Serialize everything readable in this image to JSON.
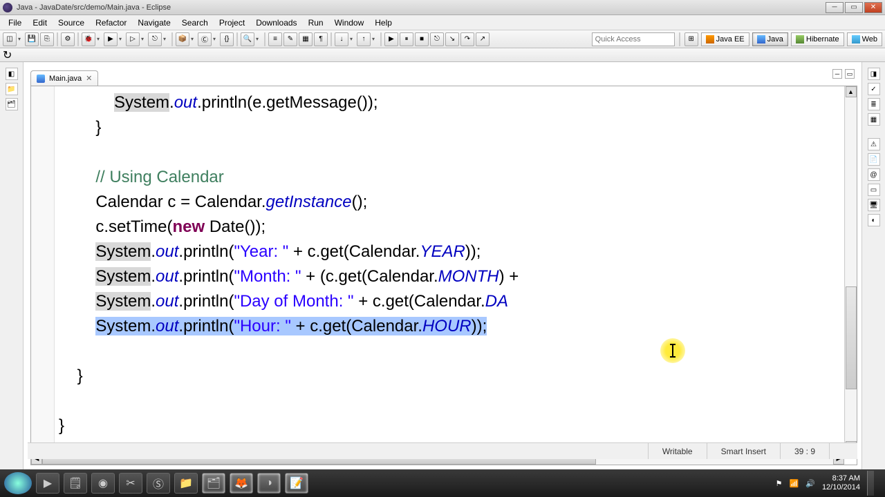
{
  "window": {
    "title": "Java - JavaDate/src/demo/Main.java - Eclipse"
  },
  "menu": {
    "file": "File",
    "edit": "Edit",
    "source": "Source",
    "refactor": "Refactor",
    "navigate": "Navigate",
    "search": "Search",
    "project": "Project",
    "downloads": "Downloads",
    "run": "Run",
    "window": "Window",
    "help": "Help"
  },
  "quickaccess": {
    "placeholder": "Quick Access"
  },
  "perspectives": {
    "javaee": "Java EE",
    "java": "Java",
    "hibernate": "Hibernate",
    "web": "Web"
  },
  "editor": {
    "tab_label": "Main.java",
    "code_prelude_sys": "System",
    "code_prelude_out": "out",
    "code_prelude_rest": ".println(e.getMessage());",
    "brace1": "}",
    "comment": "// Using Calendar",
    "l_cal_decl": "Calendar c = Calendar.",
    "l_cal_getinst": "getInstance",
    "l_cal_end": "();",
    "l_settime_a": "c.setTime(",
    "kw_new": "new",
    "l_settime_b": " Date());",
    "sys": "System",
    "out": "out",
    "pln": ".println(",
    "str_year": "\"Year: \"",
    "rest_year": " + c.get(Calendar.",
    "fld_year": "YEAR",
    "tail_year": "));",
    "str_month": "\"Month: \"",
    "rest_month": " + (c.get(Calendar.",
    "fld_month": "MONTH",
    "tail_month": ") +",
    "str_dom": "\"Day of Month: \"",
    "rest_dom": " + c.get(Calendar.",
    "fld_dom": "DA",
    "str_hour": "\"Hour: \"",
    "rest_hour": " + c.get(Calendar.",
    "fld_hour": "HOUR",
    "tail_hour": "));",
    "brace2": "}",
    "brace3": "}"
  },
  "status": {
    "writable": "Writable",
    "insert": "Smart Insert",
    "pos": "39 : 9"
  },
  "tray": {
    "time": "8:37 AM",
    "date": "12/10/2014"
  }
}
